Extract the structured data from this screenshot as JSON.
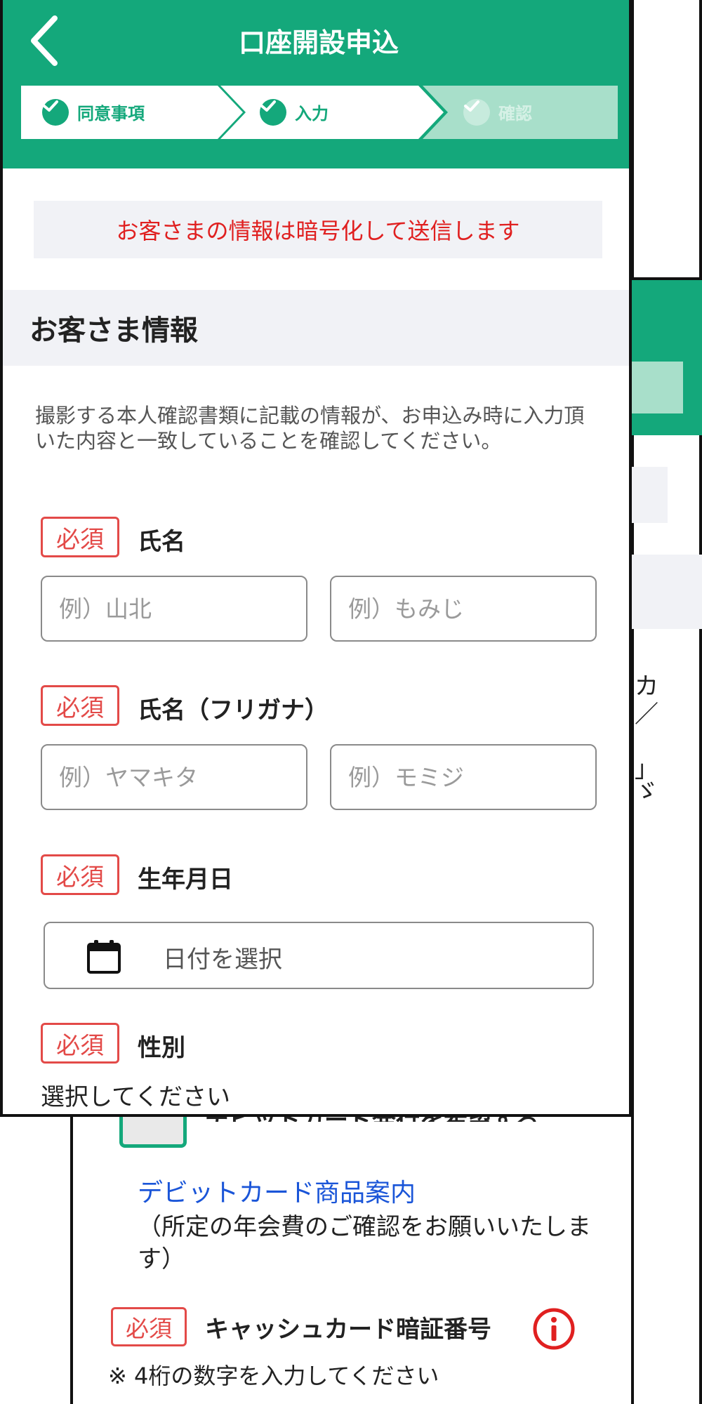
{
  "header": {
    "title": "口座開設申込",
    "steps": [
      {
        "label": "同意事項",
        "state": "done"
      },
      {
        "label": "入力",
        "state": "current"
      },
      {
        "label": "確認",
        "state": "upcoming"
      }
    ]
  },
  "notice": "お客さまの情報は暗号化して送信します",
  "section": {
    "title": "お客さま情報",
    "intro": "撮影する本人確認書類に記載の情報が、お申込み時に入力頂いた内容と一致していることを確認してください。"
  },
  "required_badge": "必須",
  "fields": {
    "name": {
      "label": "氏名",
      "last_placeholder": "例）山北",
      "first_placeholder": "例）もみじ"
    },
    "kana": {
      "label": "氏名（フリガナ）",
      "last_placeholder": "例）ヤマキタ",
      "first_placeholder": "例）モミジ"
    },
    "birthdate": {
      "label": "生年月日",
      "placeholder": "日付を選択"
    },
    "gender": {
      "label": "性別",
      "hint": "選択してください"
    }
  },
  "background_screen": {
    "fragments": [
      "カ",
      "／",
      "」",
      "ゞ"
    ],
    "debit_option": "デビットカード発行を希望する",
    "debit_link": "デビットカード商品案内",
    "debit_note": "（所定の年会費のご確認をお願いいたします）",
    "pin_required": "必須",
    "pin_label": "キャッシュカード暗証番号",
    "pin_note": "※ 4桁の数字を入力してください"
  },
  "colors": {
    "brand_green": "#14a87b",
    "required_red": "#e34a48",
    "notice_red": "#e02020",
    "link_blue": "#1a55d8"
  },
  "icons": {
    "back": "chevron-left-icon",
    "step_check": "check-circle-icon",
    "calendar": "calendar-icon",
    "info": "info-icon"
  }
}
